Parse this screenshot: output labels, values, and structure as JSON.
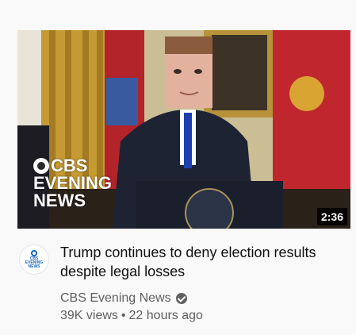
{
  "video": {
    "title": "Trump continues to deny election results despite legal losses",
    "duration": "2:36",
    "thumbnail_logo": {
      "line1": "CBS",
      "line2": "EVENING",
      "line3": "NEWS"
    },
    "channel": {
      "name": "CBS Evening News",
      "avatar_lines": [
        "CBS",
        "EVENING",
        "NEWS"
      ],
      "verified_icon": "verified-check-icon"
    },
    "views": "39K views",
    "separator": "•",
    "age": "22 hours ago"
  },
  "colors": {
    "title": "#0f0f0f",
    "secondary": "#606060",
    "background": "#f9f9f9",
    "duration_bg": "#000000",
    "cbs_blue": "#1565c0"
  }
}
